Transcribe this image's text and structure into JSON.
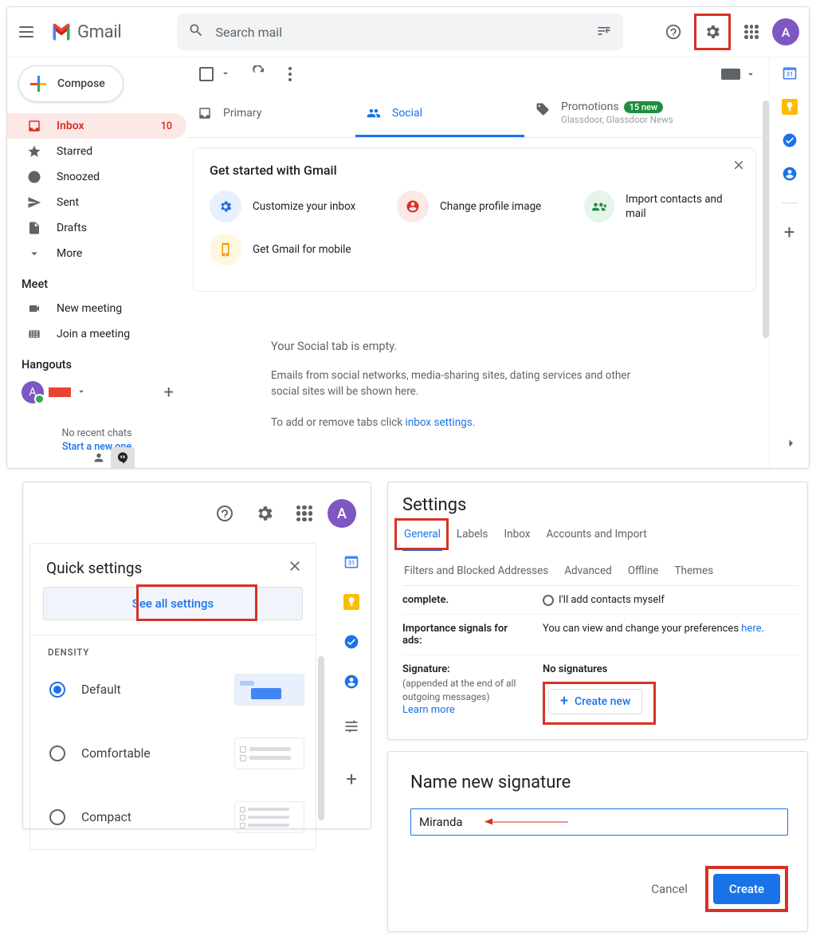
{
  "header": {
    "app_name": "Gmail",
    "search_placeholder": "Search mail",
    "avatar_letter": "A"
  },
  "sidebar": {
    "compose": "Compose",
    "items": [
      {
        "label": "Inbox",
        "count": "10"
      },
      {
        "label": "Starred"
      },
      {
        "label": "Snoozed"
      },
      {
        "label": "Sent"
      },
      {
        "label": "Drafts"
      },
      {
        "label": "More"
      }
    ],
    "meet_title": "Meet",
    "meet_new": "New meeting",
    "meet_join": "Join a meeting",
    "hangouts_title": "Hangouts",
    "hangouts_letter": "A",
    "no_chats": "No recent chats",
    "start_new": "Start a new one"
  },
  "tabs": {
    "primary": "Primary",
    "social": "Social",
    "promotions": "Promotions",
    "promo_badge": "15 new",
    "promo_sub": "Glassdoor, Glassdoor News"
  },
  "getstarted": {
    "title": "Get started with Gmail",
    "i1": "Customize your inbox",
    "i2": "Change profile image",
    "i3": "Import contacts and mail",
    "i4": "Get Gmail for mobile"
  },
  "empty": {
    "title": "Your Social tab is empty.",
    "body": "Emails from social networks, media-sharing sites, dating services and other social sites will be shown here.",
    "line2a": "To add or remove tabs click ",
    "line2b": "inbox settings",
    "dot": "."
  },
  "quicksettings": {
    "title": "Quick settings",
    "see_all": "See all settings",
    "density": "DENSITY",
    "d1": "Default",
    "d2": "Comfortable",
    "d3": "Compact"
  },
  "settings": {
    "title": "Settings",
    "tabs": [
      "General",
      "Labels",
      "Inbox",
      "Accounts and Import",
      "Filters and Blocked Addresses",
      "Advanced",
      "Offline",
      "Themes"
    ],
    "complete_label": "complete.",
    "complete_opt": "I'll add contacts myself",
    "importance_label": "Importance signals for ads:",
    "importance_text": "You can view and change your preferences ",
    "here": "here",
    "dot": ".",
    "sig_label": "Signature:",
    "sig_sub": "(appended at the end of all outgoing messages)",
    "learn": "Learn more",
    "nosig": "No signatures",
    "create_new": "Create new"
  },
  "dialog": {
    "title": "Name new signature",
    "value": "Miranda",
    "cancel": "Cancel",
    "create": "Create"
  }
}
